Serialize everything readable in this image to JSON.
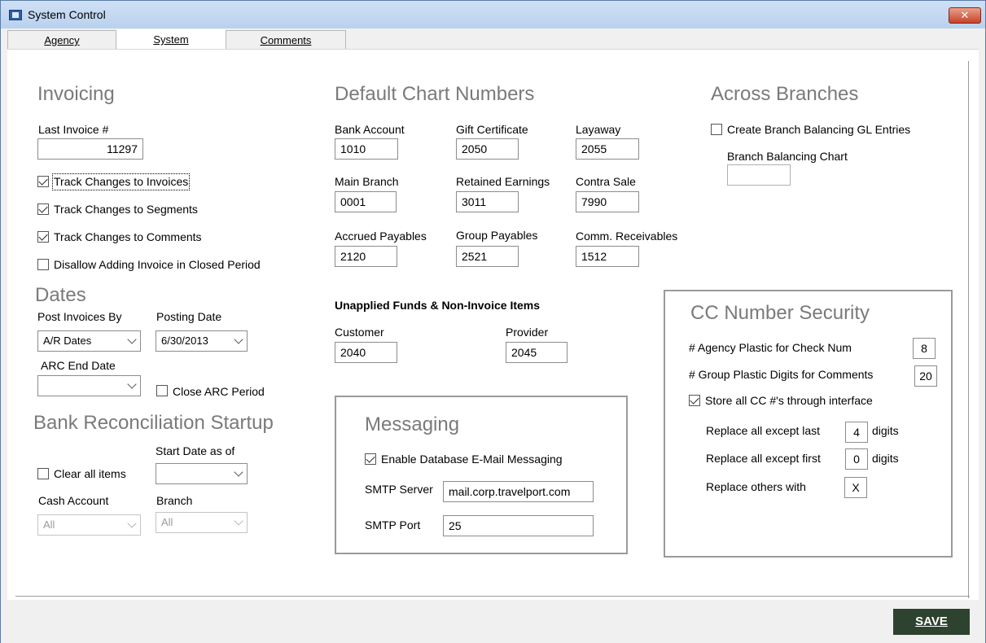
{
  "window": {
    "title": "System Control",
    "close_glyph": "✕"
  },
  "tabs": [
    {
      "label": "Agency",
      "active": false
    },
    {
      "label": "System",
      "active": true
    },
    {
      "label": "Comments",
      "active": false
    }
  ],
  "invoicing": {
    "heading": "Invoicing",
    "last_invoice_label": "Last Invoice #",
    "last_invoice_value": "11297",
    "checkboxes": [
      {
        "label": "Track Changes to Invoices",
        "checked": true
      },
      {
        "label": "Track Changes to Segments",
        "checked": true
      },
      {
        "label": "Track Changes to Comments",
        "checked": true
      },
      {
        "label": "Disallow Adding Invoice in Closed Period",
        "checked": false
      }
    ]
  },
  "dates": {
    "heading": "Dates",
    "post_by_label": "Post Invoices By",
    "post_by_value": "A/R Dates",
    "posting_date_label": "Posting Date",
    "posting_date_value": "6/30/2013",
    "arc_end_label": "ARC End Date",
    "arc_end_value": "",
    "close_arc_label": "Close ARC Period",
    "close_arc_checked": false
  },
  "bank_rec": {
    "heading": "Bank Reconciliation Startup",
    "start_date_label": "Start Date as of",
    "start_date_value": "",
    "clear_all_label": "Clear all items",
    "clear_all_checked": false,
    "cash_account_label": "Cash Account",
    "cash_account_value": "All",
    "branch_label": "Branch",
    "branch_value": "All"
  },
  "chart_numbers": {
    "heading": "Default Chart Numbers",
    "fields": {
      "bank_account": {
        "label": "Bank Account",
        "value": "1010"
      },
      "gift_certificate": {
        "label": "Gift Certificate",
        "value": "2050"
      },
      "layaway": {
        "label": "Layaway",
        "value": "2055"
      },
      "main_branch": {
        "label": "Main Branch",
        "value": "0001"
      },
      "retained_earnings": {
        "label": "Retained Earnings",
        "value": "3011"
      },
      "contra_sale": {
        "label": "Contra Sale",
        "value": "7990"
      },
      "accrued_payables": {
        "label": "Accrued Payables",
        "value": "2120"
      },
      "group_payables": {
        "label": "Group Payables",
        "value": "2521"
      },
      "comm_receivables": {
        "label": "Comm. Receivables",
        "value": "1512"
      }
    }
  },
  "unapplied": {
    "heading": "Unapplied Funds & Non-Invoice Items",
    "customer_label": "Customer",
    "customer_value": "2040",
    "provider_label": "Provider",
    "provider_value": "2045"
  },
  "messaging": {
    "heading": "Messaging",
    "enable_label": "Enable Database E-Mail Messaging",
    "enable_checked": true,
    "smtp_server_label": "SMTP Server",
    "smtp_server_value": "mail.corp.travelport.com",
    "smtp_port_label": "SMTP Port",
    "smtp_port_value": "25"
  },
  "across_branches": {
    "heading": "Across Branches",
    "create_label": "Create Branch Balancing GL Entries",
    "create_checked": false,
    "chart_label": "Branch Balancing Chart",
    "chart_value": ""
  },
  "cc_security": {
    "heading": "CC Number Security",
    "agency_plastic_label": "# Agency Plastic for Check Num",
    "agency_plastic_value": "8",
    "group_plastic_label": "# Group Plastic Digits for Comments",
    "group_plastic_value": "20",
    "store_all_label": "Store all CC #'s through interface",
    "store_all_checked": true,
    "replace_last_label": "Replace all except last",
    "replace_last_value": "4",
    "replace_first_label": "Replace all except first",
    "replace_first_value": "0",
    "digits_label": "digits",
    "replace_others_label": "Replace others with",
    "replace_others_value": "X"
  },
  "footer": {
    "save_label": "SAVE"
  }
}
